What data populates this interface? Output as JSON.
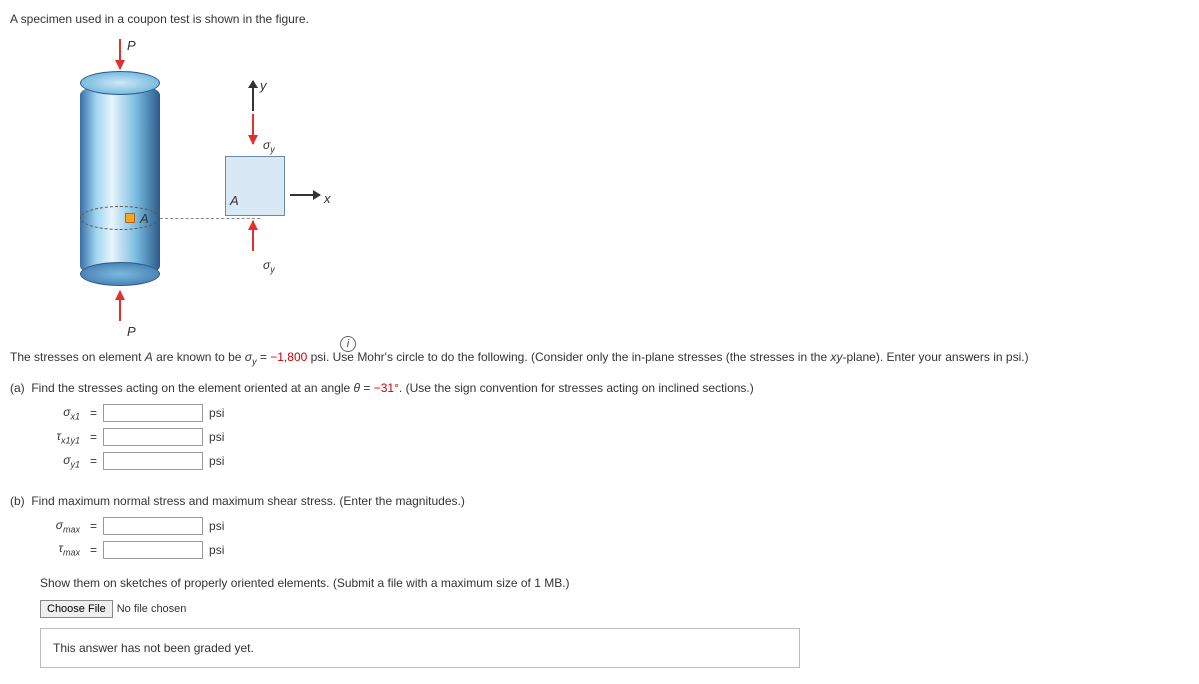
{
  "intro": "A specimen used in a coupon test is shown in the figure.",
  "figure": {
    "force_label": "P",
    "point_label": "A",
    "element_label": "A",
    "axis_x": "x",
    "axis_y": "y",
    "sigma_y": "σ",
    "sigma_y_sub": "y",
    "info": "i"
  },
  "prompt": {
    "pre": "The stresses on element ",
    "elem": "A",
    "mid1": " are known to be ",
    "var": "σ",
    "var_sub": "y",
    "eq": " = ",
    "val": "−1,800",
    "mid2": " psi. Use Mohr's circle to do the following. (Consider only the in-plane stresses (the stresses in the ",
    "plane": "xy",
    "mid3": "-plane). Enter your answers in psi.)"
  },
  "partA": {
    "label": "(a)",
    "text1": "Find the stresses acting on the element oriented at an angle ",
    "theta": "θ",
    "eq": " = ",
    "val": "−31°",
    "text2": ". (Use the sign convention for stresses acting on inclined sections.)",
    "rows": [
      {
        "sym": "σ",
        "sub": "x1"
      },
      {
        "sym": "τ",
        "sub": "x1y1"
      },
      {
        "sym": "σ",
        "sub": "y1"
      }
    ],
    "unit": "psi"
  },
  "partB": {
    "label": "(b)",
    "text": "Find maximum normal stress and maximum shear stress. (Enter the magnitudes.)",
    "rows": [
      {
        "sym": "σ",
        "sub": "max"
      },
      {
        "sym": "τ",
        "sub": "max"
      }
    ],
    "unit": "psi",
    "sketch_prompt": "Show them on sketches of properly oriented elements. (Submit a file with a maximum size of 1 MB.)",
    "choose_file": "Choose File",
    "no_file": "No file chosen",
    "grade_note": "This answer has not been graded yet."
  }
}
